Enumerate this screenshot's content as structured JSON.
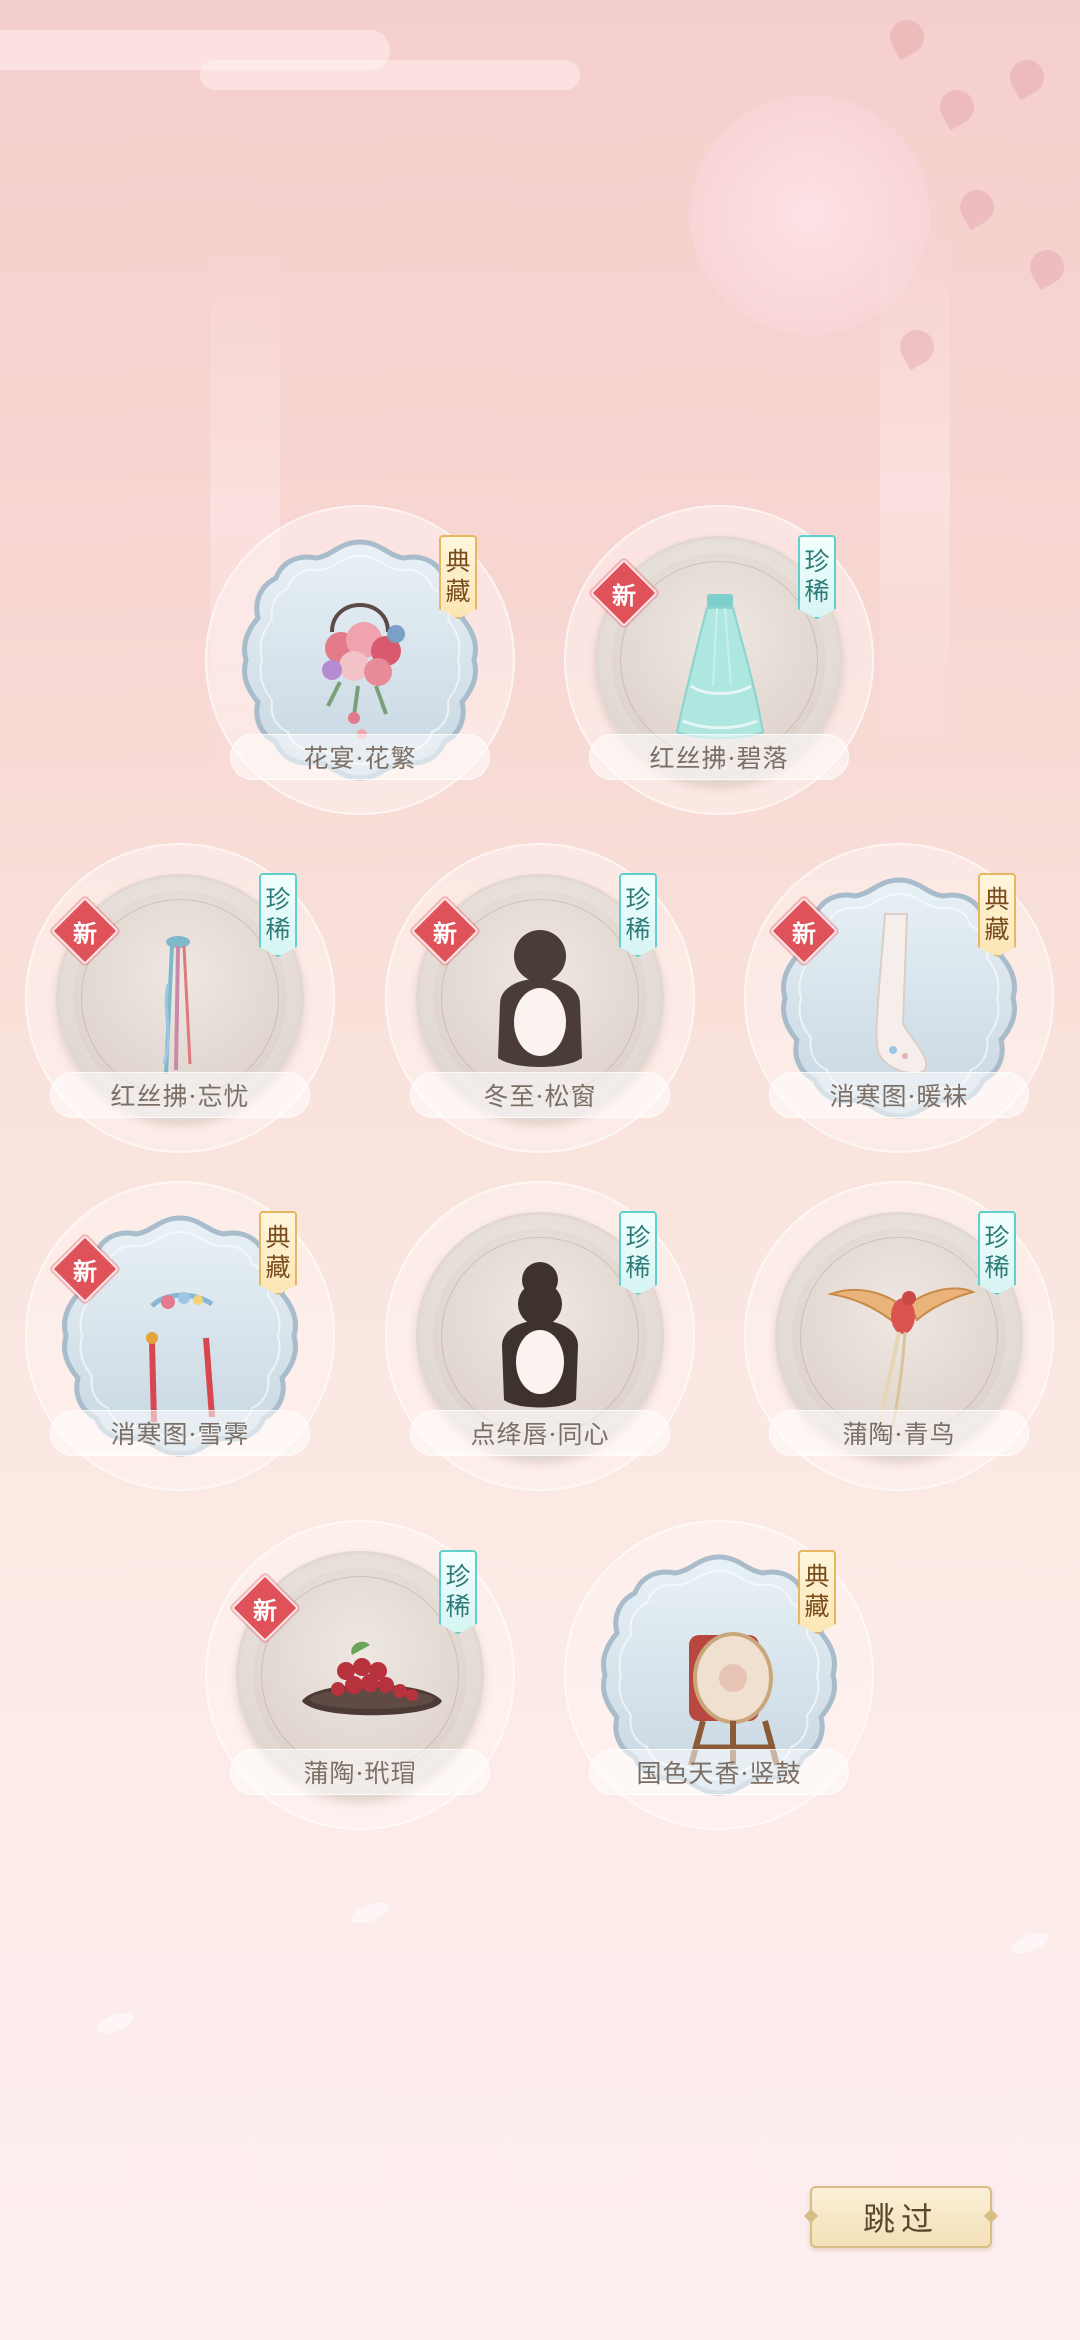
{
  "items": [
    {
      "name": "花宴·花繁",
      "rarity": "典藏",
      "is_new": false,
      "icon": "flower-bouquet-icon"
    },
    {
      "name": "红丝拂·碧落",
      "rarity": "珍稀",
      "is_new": true,
      "icon": "skirt-icon"
    },
    {
      "name": "红丝拂·忘忧",
      "rarity": "珍稀",
      "is_new": true,
      "icon": "hairpin-ribbon-icon"
    },
    {
      "name": "冬至·松窗",
      "rarity": "珍稀",
      "is_new": true,
      "icon": "hairstyle-bun-icon"
    },
    {
      "name": "消寒图·暖袜",
      "rarity": "典藏",
      "is_new": true,
      "icon": "socks-icon"
    },
    {
      "name": "消寒图·雪霁",
      "rarity": "典藏",
      "is_new": true,
      "icon": "hair-ornament-icon"
    },
    {
      "name": "点绛唇·同心",
      "rarity": "珍稀",
      "is_new": false,
      "icon": "hairstyle-double-bun-icon"
    },
    {
      "name": "蒲陶·青鸟",
      "rarity": "珍稀",
      "is_new": false,
      "icon": "bird-icon"
    },
    {
      "name": "蒲陶·玳瑁",
      "rarity": "珍稀",
      "is_new": true,
      "icon": "grapes-plate-icon"
    },
    {
      "name": "国色天香·竖鼓",
      "rarity": "典藏",
      "is_new": false,
      "icon": "drum-icon"
    }
  ],
  "badges": {
    "new": "新"
  },
  "skip_label": "跳过",
  "colors": {
    "collection_badge": "#e6b75e",
    "rare_badge": "#5fd0cb",
    "new_badge": "#e0525a",
    "label_text": "#7c6f66"
  }
}
